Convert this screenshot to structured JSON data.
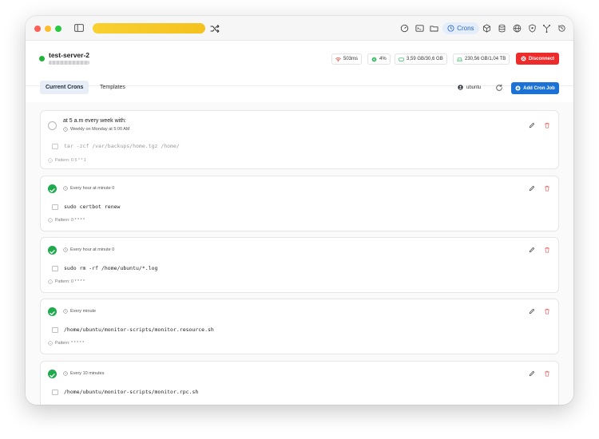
{
  "toolbar": {
    "active_label": "Crons",
    "icons": [
      "dashboard-icon",
      "terminal-icon",
      "folder-icon",
      "clock-icon",
      "package-icon",
      "database-icon",
      "globe-icon",
      "shield-icon",
      "network-icon",
      "history-icon"
    ]
  },
  "server": {
    "name": "test-server-2",
    "status_color": "#22b33b",
    "latency": "503ms",
    "cpu": "4%",
    "memory": "3,59 GB/30,6 GB",
    "disk": "230,56 GB/1,04 TB",
    "disconnect_label": "Disconnect"
  },
  "tabs": {
    "current": "Current Crons",
    "templates": "Templates"
  },
  "user": "ubuntu",
  "add_label": "Add Cron Job",
  "crons": [
    {
      "enabled": false,
      "title": "at 5 a.m every week with:",
      "schedule": "Weekly on Monday at 5:00 AM",
      "command": "tar -zcf /var/backups/home.tgz /home/",
      "pattern": "Pattern: 0 5 * * 1"
    },
    {
      "enabled": true,
      "schedule": "Every hour at minute 0",
      "command": "sudo certbot renew",
      "pattern": "Pattern: 0 * * * *"
    },
    {
      "enabled": true,
      "schedule": "Every hour at minute 0",
      "command": "sudo rm -rf /home/ubuntu/*.log",
      "pattern": "Pattern: 0 * * * *"
    },
    {
      "enabled": true,
      "schedule": "Every minute",
      "command": "/home/ubuntu/monitor-scripts/monitor.resource.sh",
      "pattern": "Pattern: * * * * *"
    },
    {
      "enabled": true,
      "schedule": "Every 10 minutes",
      "command": "/home/ubuntu/monitor-scripts/monitor.rpc.sh"
    }
  ],
  "colors": {
    "accent": "#1b72d4",
    "danger": "#ee2b2b",
    "success": "#1faa4e",
    "tab_pill": "#f4c21f"
  }
}
